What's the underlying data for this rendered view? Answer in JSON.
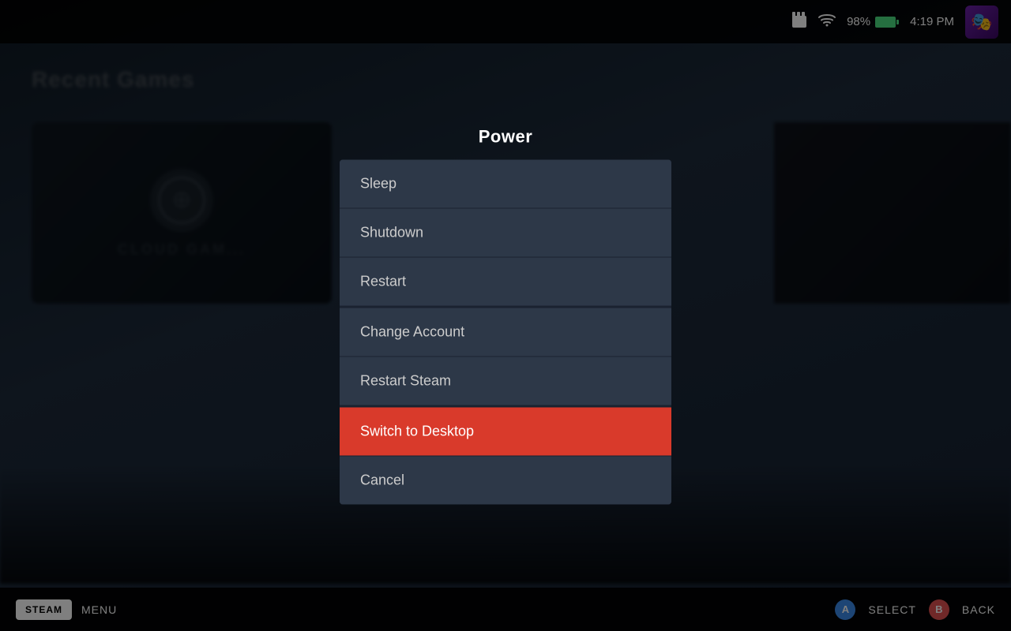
{
  "statusBar": {
    "batteryPercent": "98%",
    "time": "4:19 PM",
    "avatarEmoji": "🎭"
  },
  "background": {
    "title": "Recent Games",
    "cloudGamingLabel": "CLOUD GAM..."
  },
  "powerDialog": {
    "title": "Power",
    "menuItems": [
      {
        "id": "sleep",
        "label": "Sleep",
        "active": false,
        "separator": false
      },
      {
        "id": "shutdown",
        "label": "Shutdown",
        "active": false,
        "separator": false
      },
      {
        "id": "restart",
        "label": "Restart",
        "active": false,
        "separator": false
      },
      {
        "id": "change-account",
        "label": "Change Account",
        "active": false,
        "separator": true
      },
      {
        "id": "restart-steam",
        "label": "Restart Steam",
        "active": false,
        "separator": false
      },
      {
        "id": "switch-desktop",
        "label": "Switch to Desktop",
        "active": true,
        "separator": true
      },
      {
        "id": "cancel",
        "label": "Cancel",
        "active": false,
        "separator": false
      }
    ]
  },
  "bottomBar": {
    "steamLabel": "STEAM",
    "menuLabel": "MENU",
    "selectLabel": "SELECT",
    "backLabel": "BACK",
    "btnALabel": "A",
    "btnBLabel": "B"
  },
  "colors": {
    "activeItemBg": "#d93a2b",
    "menuBg": "#2d3848",
    "batteryGreen": "#4ade80"
  }
}
